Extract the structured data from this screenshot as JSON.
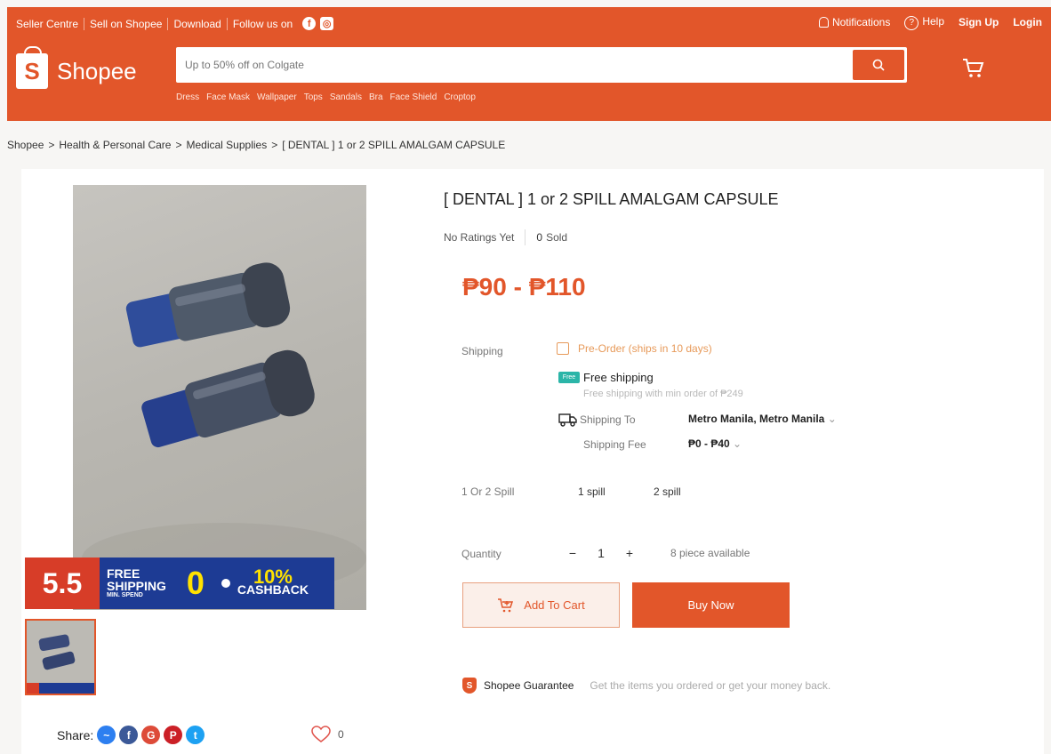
{
  "header": {
    "links": [
      "Seller Centre",
      "Sell on Shopee",
      "Download",
      "Follow us on"
    ],
    "notifications": "Notifications",
    "help": "Help",
    "signup": "Sign Up",
    "login": "Login",
    "logo_text": "Shopee",
    "logo_letter": "S",
    "search_placeholder": "Up to 50% off on Colgate",
    "suggestions": [
      "Dress",
      "Face Mask",
      "Wallpaper",
      "Tops",
      "Sandals",
      "Bra",
      "Face Shield",
      "Croptop"
    ]
  },
  "breadcrumb": [
    "Shopee",
    "Health & Personal Care",
    "Medical Supplies",
    "[ DENTAL ] 1 or 2 SPILL AMALGAM CAPSULE"
  ],
  "product": {
    "title": "[ DENTAL ] 1 or 2 SPILL AMALGAM CAPSULE",
    "ratings": "No Ratings Yet",
    "sold_count": "0",
    "sold_label": "Sold",
    "price": "₱90 - ₱110",
    "shipping_label": "Shipping",
    "preorder": "Pre-Order (ships in 10 days)",
    "free_shipping": "Free shipping",
    "free_shipping_tag": "Free",
    "free_shipping_note": "Free shipping with min order of ₱249",
    "shipping_to_label": "Shipping To",
    "shipping_to_value": "Metro Manila, Metro Manila",
    "shipping_fee_label": "Shipping Fee",
    "shipping_fee_value": "₱0 - ₱40",
    "variant_label": "1 Or 2 Spill",
    "variants": [
      "1 spill",
      "2 spill"
    ],
    "quantity_label": "Quantity",
    "quantity_value": "1",
    "stock": "8 piece available",
    "add_to_cart": "Add To Cart",
    "buy_now": "Buy Now",
    "guarantee_title": "Shopee Guarantee",
    "guarantee_note": "Get the items you ordered or get your money back."
  },
  "banner": {
    "num": "5.5",
    "free_line1": "FREE",
    "free_line2": "SHIPPING",
    "min_spend": "MIN. SPEND",
    "zero": "0",
    "cashback_pct": "10%",
    "cashback": "CASHBACK"
  },
  "share": {
    "label": "Share:",
    "likes": "0"
  },
  "colors": {
    "brand": "#e2562a",
    "banner_blue": "#1d3b94"
  }
}
